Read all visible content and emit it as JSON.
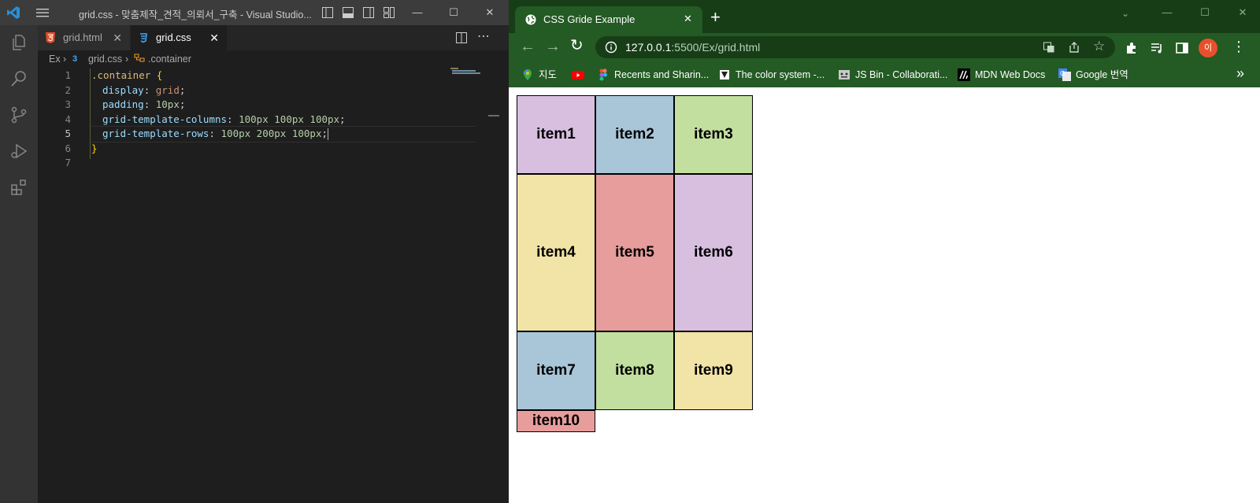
{
  "vscode": {
    "window_title": "grid.css - 맞춤제작_견적_의뢰서_구축 - Visual Studio...",
    "tabs": [
      {
        "label": "grid.html",
        "icon": "html5-icon",
        "active": false
      },
      {
        "label": "grid.css",
        "icon": "css-icon",
        "active": true
      }
    ],
    "breadcrumb": [
      "Ex",
      "grid.css",
      ".container"
    ],
    "code": {
      "line_numbers": [
        "1",
        "2",
        "3",
        "4",
        "5",
        "6",
        "7"
      ],
      "line1": {
        "selector": ".container",
        "brace": "{"
      },
      "line2": {
        "prop": "display",
        "value": "grid"
      },
      "line3": {
        "prop": "padding",
        "value": "10px"
      },
      "line4": {
        "prop": "grid-template-columns",
        "value": "100px 100px 100px"
      },
      "line5": {
        "prop": "grid-template-rows",
        "value": "100px 200px 100px"
      },
      "line6": {
        "brace": "}"
      },
      "colon": ":",
      "semicolon": ";"
    }
  },
  "chrome": {
    "tab_title": "CSS Gride Example",
    "new_tab": "+",
    "url_host": "127.0.0.1",
    "url_rest": ":5500/Ex/grid.html",
    "profile_initial": "이",
    "bookmarks": [
      {
        "label": "지도",
        "icon": "maps-icon"
      },
      {
        "label": "",
        "icon": "youtube-icon"
      },
      {
        "label": "Recents and Sharin...",
        "icon": "figma-icon"
      },
      {
        "label": "The color system -...",
        "icon": "material-icon"
      },
      {
        "label": "JS Bin - Collaborati...",
        "icon": "jsbin-icon"
      },
      {
        "label": "MDN Web Docs",
        "icon": "mdn-icon"
      },
      {
        "label": "Google 번역",
        "icon": "google-translate-icon"
      }
    ],
    "bookmarks_more": "»",
    "grid_items": [
      {
        "label": "item1",
        "color": "#d8bfe0"
      },
      {
        "label": "item2",
        "color": "#a9c6d8"
      },
      {
        "label": "item3",
        "color": "#c2df9f"
      },
      {
        "label": "item4",
        "color": "#f2e4a6"
      },
      {
        "label": "item5",
        "color": "#e69d9b"
      },
      {
        "label": "item6",
        "color": "#d8bfe0"
      },
      {
        "label": "item7",
        "color": "#a9c6d8"
      },
      {
        "label": "item8",
        "color": "#c2df9f"
      },
      {
        "label": "item9",
        "color": "#f2e4a6"
      },
      {
        "label": "item10",
        "color": "#e69d9b"
      }
    ]
  },
  "colors": {
    "vscode_bg": "#1e1e1e",
    "chrome_frame": "#245a24",
    "chrome_tabstrip": "#173d17",
    "profile_avatar": "#e8502c"
  }
}
